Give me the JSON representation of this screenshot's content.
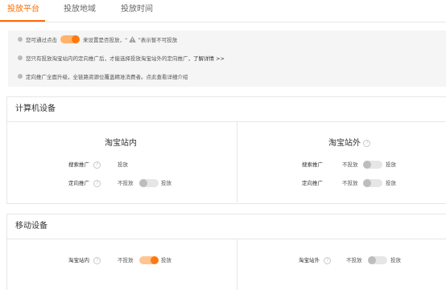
{
  "tabs": [
    {
      "label": "投放平台"
    },
    {
      "label": "投放地域"
    },
    {
      "label": "投放时间"
    }
  ],
  "notice": {
    "line1_before": "您可通过点击",
    "line1_after": "来设置是否投放，“",
    "line1_after2": "”表示暂不可投放",
    "line2_text": "您只有投放淘宝站内的定向推广后，才能选择投放淘宝站外的定向推广，",
    "line2_link": "了解详情 >>",
    "line3_text": "定向推广全面升级，全链路资源位覆盖精准消费者。点此查看详细介绍"
  },
  "computer": {
    "title": "计算机设备",
    "inside": {
      "title": "淘宝站内",
      "search_label": "搜索推广",
      "search_value": "投放",
      "target_label": "定向推广",
      "target_off": "不投放",
      "target_on": "投放"
    },
    "outside": {
      "title": "淘宝站外",
      "search_label": "搜索推广",
      "search_off": "不投放",
      "search_on": "投放",
      "target_label": "定向推广",
      "target_off": "不投放",
      "target_on": "投放"
    }
  },
  "mobile": {
    "title": "移动设备",
    "inside": {
      "label": "淘宝站内",
      "off": "不投放",
      "on": "投放"
    },
    "outside": {
      "label": "淘宝站外",
      "off": "不投放",
      "on": "投放"
    }
  },
  "icons": {
    "bullet": "info-dot-icon",
    "warning": "warning-triangle-icon",
    "help": "question-circle-icon"
  },
  "colors": {
    "accent": "#ff6a00",
    "switch_on_track": "#ffc592",
    "switch_on_knob": "#ff7a12",
    "switch_off_track": "#e6e6e6"
  }
}
